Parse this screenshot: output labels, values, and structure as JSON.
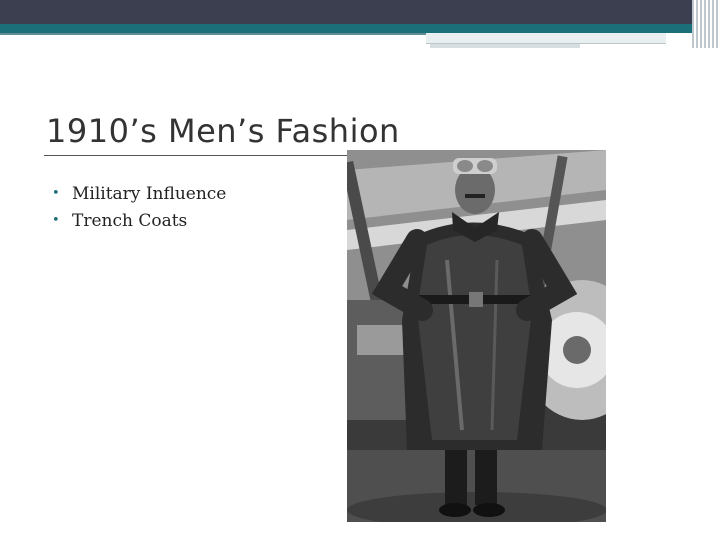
{
  "slide": {
    "title": "1910’s Men’s Fashion",
    "bullets": [
      "Military Influence",
      "Trench Coats"
    ],
    "bullet_glyph": "•",
    "photo_icon": "photo-aviator-trench-coat"
  },
  "colors": {
    "header_dark": "#3c3f4f",
    "header_teal": "#1b6f78",
    "title_text": "#333333",
    "bullet_accent": "#1b6f78"
  }
}
